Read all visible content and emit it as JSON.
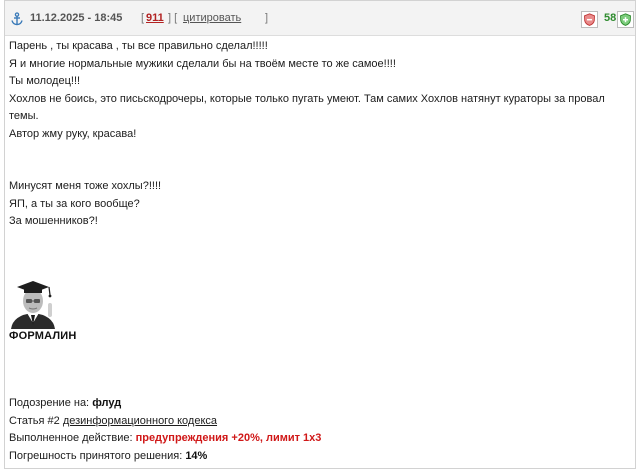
{
  "header": {
    "date": "11.12.2025 - 18:45",
    "bracket_open": "[",
    "bracket_mid": "] [",
    "bracket_close": "]",
    "post_number": "911",
    "quote_label": "цитировать",
    "score": "58",
    "score_color": "#2e8b2e",
    "accent_red": "#b22222"
  },
  "body": {
    "lines": [
      "Парень , ты красава , ты все правильно сделал!!!!!",
      "Я и многие нормальные мужики сделали бы на твоём месте то же самое!!!!",
      "Ты молодец!!!",
      "Хохлов не боись, это письскодрочеры, которые только пугать умеют. Там самих Хохлов натянут кураторы за провал",
      "темы.",
      "Автор жму руку, красава!",
      "",
      "",
      "Минусят меня тоже хохлы?!!!!",
      "ЯП, а ты за кого вообще?",
      "За мошенников?!"
    ]
  },
  "author": {
    "name": "ФОРМАЛИН"
  },
  "verdict": {
    "suspicion_label": "Подозрение на:",
    "suspicion_value": "флуд",
    "article_prefix": "Статья #2",
    "article_link": "дезинформационного кодекса",
    "action_label": "Выполненное действие:",
    "action_value": "предупреждения +20%, лимит 1х3",
    "error_label": "Погрешность принятого решения:",
    "error_value": "14%",
    "warning_color": "#d01818"
  }
}
